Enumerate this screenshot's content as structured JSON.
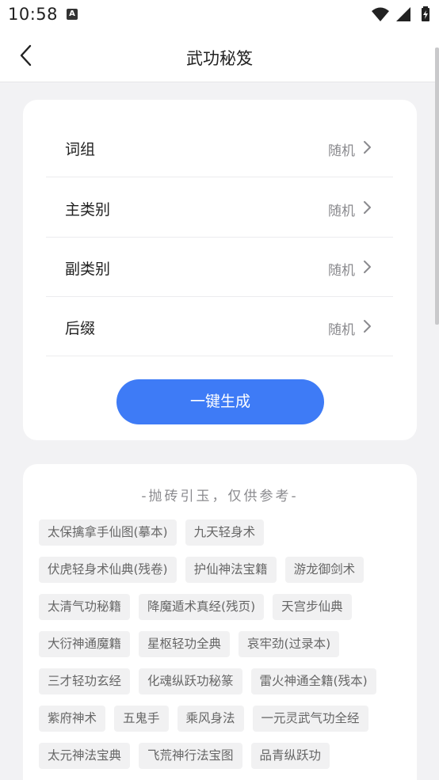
{
  "status_bar": {
    "time": "10:58",
    "notification_icon": "A"
  },
  "nav": {
    "back_icon": "chevron-left",
    "title": "武功秘笈"
  },
  "options": [
    {
      "label": "词组",
      "value": "随机"
    },
    {
      "label": "主类别",
      "value": "随机"
    },
    {
      "label": "副类别",
      "value": "随机"
    },
    {
      "label": "后缀",
      "value": "随机"
    }
  ],
  "generate_button_label": "一键生成",
  "examples_heading": "-抛砖引玉，仅供参考-",
  "examples": [
    "太保擒拿手仙图(摹本)",
    "九天轻身术",
    "伏虎轻身术仙典(残卷)",
    "护仙神法宝籍",
    "游龙御剑术",
    "太清气功秘籍",
    "降魔遁术真经(残页)",
    "天宫步仙典",
    "大衍神通魔籍",
    "星枢轻功全典",
    "哀牢劲(过录本)",
    "三才轻功玄经",
    "化魂纵跃功秘篆",
    "雷火神通全籍(残本)",
    "紫府神术",
    "五鬼手",
    "乘风身法",
    "一元灵武气功全经",
    "太元神法宝典",
    "飞荒神行法宝图",
    "品青纵跃功"
  ],
  "colors": {
    "accent": "#3e7bf6",
    "background": "#f2f2f4",
    "tag_bg": "#f1f1f2"
  }
}
